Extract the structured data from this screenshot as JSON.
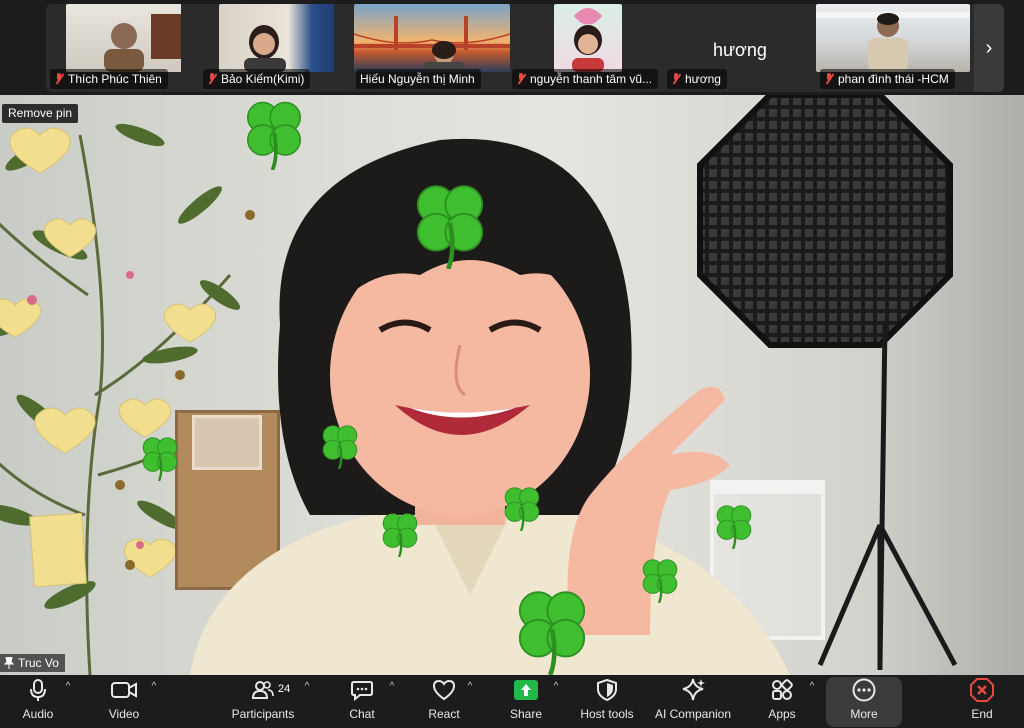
{
  "participants": [
    {
      "name": "Thích Phúc Thiên",
      "muted": true
    },
    {
      "name": "Bảo Kiếm(Kimi)",
      "muted": true
    },
    {
      "name": "Hiếu Nguyễn thị Minh",
      "muted": false
    },
    {
      "name": "nguyễn thanh tâm  vũ...",
      "muted": true
    },
    {
      "name": "hương",
      "muted": true,
      "display_name": "hương"
    },
    {
      "name": "phan đình thái -HCM",
      "muted": true
    }
  ],
  "strip_next_glyph": "›",
  "remove_pin_label": "Remove pin",
  "speaker_name": "Truc Vo",
  "toolbar": {
    "audio": "Audio",
    "video": "Video",
    "participants": "Participants",
    "participants_count": "24",
    "chat": "Chat",
    "react": "React",
    "share": "Share",
    "host_tools": "Host tools",
    "ai_companion": "AI Companion",
    "apps": "Apps",
    "more": "More",
    "end": "End"
  },
  "colors": {
    "share_green": "#22b84a",
    "end_red": "#e8483f",
    "muted_red": "#e8483f",
    "clover_green": "#3fbf2f"
  }
}
